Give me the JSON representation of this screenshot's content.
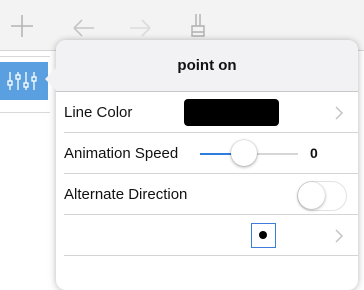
{
  "toolbar": {
    "icons": [
      "plus-icon",
      "undo-icon",
      "redo-icon",
      "brush-icon"
    ]
  },
  "sidebar": {
    "icon": "sliders-icon",
    "accent_color": "#5aa0e0"
  },
  "popover": {
    "title": "point on",
    "rows": {
      "line_color": {
        "label": "Line Color",
        "color": "#000000"
      },
      "animation_speed": {
        "label": "Animation Speed",
        "value": "0",
        "level": 0.45
      },
      "alternate_direction": {
        "label": "Alternate Direction",
        "on": false
      },
      "point_style": {
        "selected": "filled-dot"
      }
    }
  },
  "colors": {
    "accent": "#2f7de1",
    "toolbar_bg": "#f3f3f3"
  }
}
